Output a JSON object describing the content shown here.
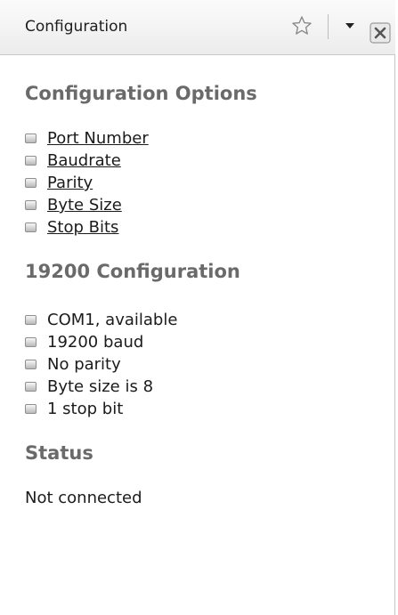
{
  "panel": {
    "title": "Configuration",
    "icons": {
      "star": "star-icon",
      "dropdown": "dropdown-arrow-icon",
      "close": "close-icon"
    }
  },
  "sections": {
    "options": {
      "heading": "Configuration Options",
      "items": [
        "Port Number",
        "Baudrate",
        "Parity",
        "Byte Size",
        "Stop Bits"
      ]
    },
    "current": {
      "heading": "19200 Configuration",
      "items": [
        "COM1, available",
        "19200 baud",
        "No parity",
        "Byte size is 8",
        "1 stop bit"
      ]
    },
    "status": {
      "heading": "Status",
      "text": "Not connected"
    }
  },
  "colors": {
    "heading": "#6a6a6a",
    "text": "#1b1b1b",
    "titlebar": "#ececec"
  }
}
